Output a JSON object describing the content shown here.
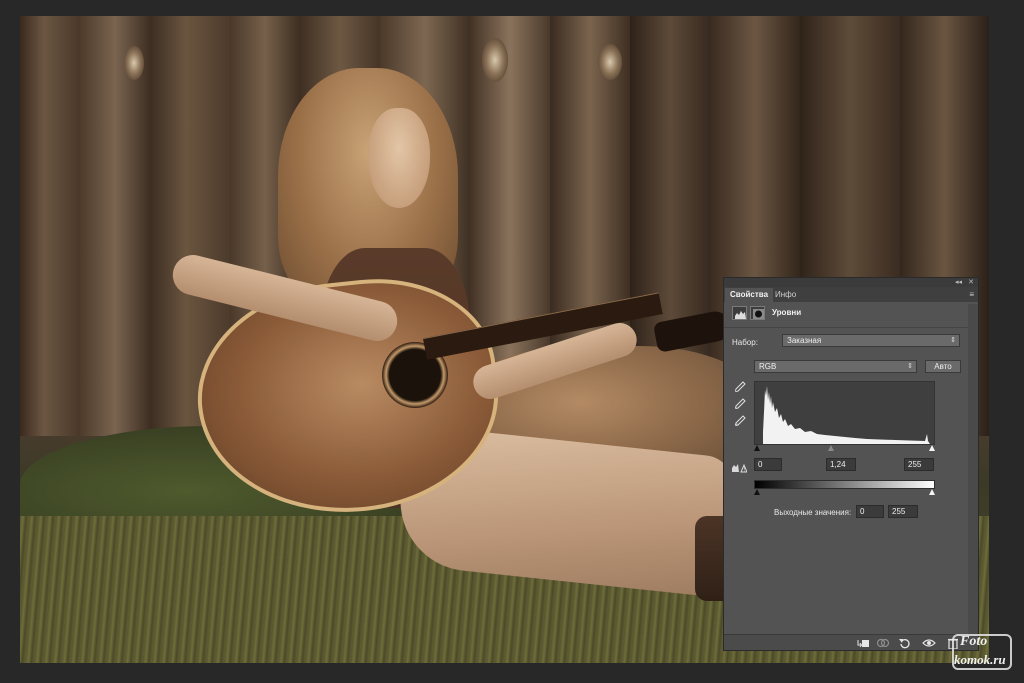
{
  "panel": {
    "tabs": [
      {
        "label": "Свойства",
        "active": true
      },
      {
        "label": "Инфо",
        "active": false
      }
    ],
    "collapse_glyph": "◂◂",
    "close_glyph": "✕",
    "menu_glyph": "≡",
    "title": "Уровни",
    "preset": {
      "label": "Набор:",
      "value": "Заказная"
    },
    "channel": {
      "value": "RGB"
    },
    "auto_label": "Авто",
    "input_levels": {
      "black": "0",
      "gamma": "1,24",
      "white": "255"
    },
    "output": {
      "label": "Выходные значения:",
      "black": "0",
      "white": "255"
    },
    "icons": [
      "levels-icon",
      "mask-icon",
      "eyedropper-black-icon",
      "eyedropper-gray-icon",
      "eyedropper-white-icon",
      "clipping-warning-icon",
      "clip-to-layer-icon",
      "view-previous-state-icon",
      "reset-icon",
      "visibility-eye-icon",
      "trash-icon"
    ]
  },
  "watermark": {
    "line1": "Foto",
    "line2": "komok.ru"
  },
  "colors": {
    "panel_bg": "#535353",
    "app_bg": "#282828",
    "field_bg": "#3b3b3b"
  }
}
